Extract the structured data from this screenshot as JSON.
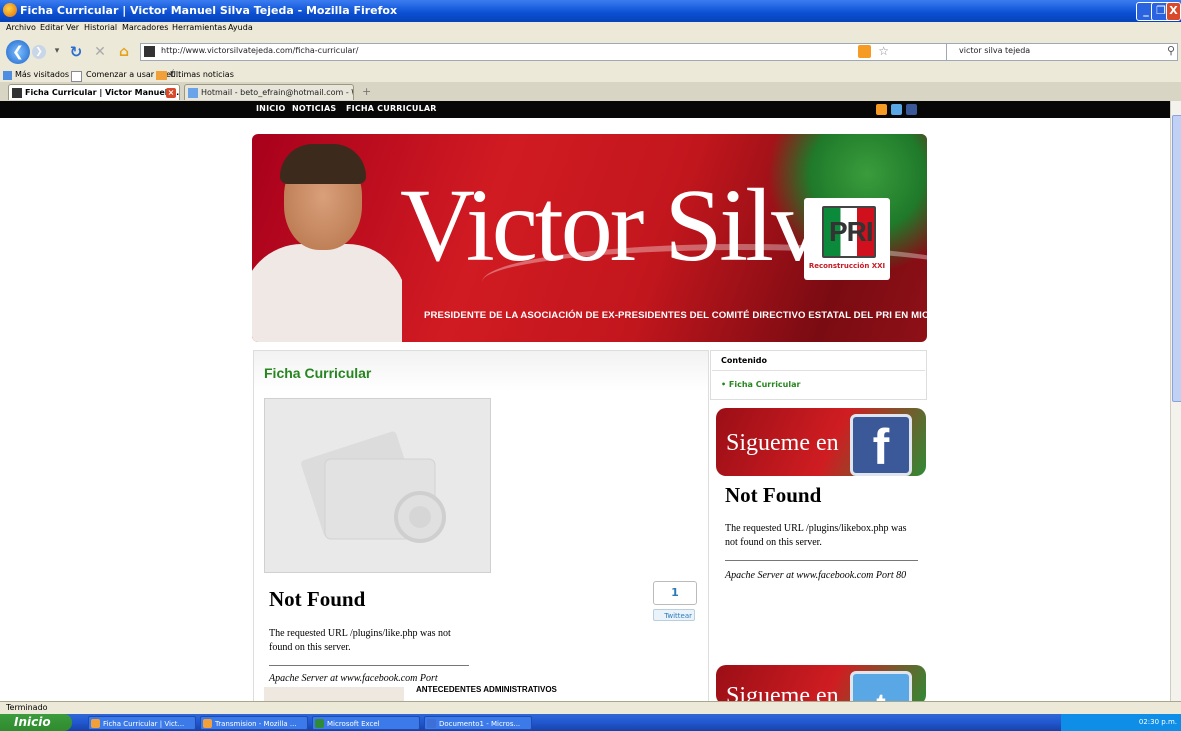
{
  "window": {
    "title": "Ficha Curricular | Victor Manuel Silva Tejeda - Mozilla Firefox",
    "controls": [
      "_",
      "❐",
      "X"
    ]
  },
  "menu": [
    "Archivo",
    "Editar",
    "Ver",
    "Historial",
    "Marcadores",
    "Herramientas",
    "Ayuda"
  ],
  "navigation": {
    "url": "http://www.victorsilvatejeda.com/ficha-curricular/",
    "search_value": "victor silva tejeda"
  },
  "bookmarks": [
    "Más visitados",
    "Comenzar a usar Firef...",
    "Últimas noticias"
  ],
  "tabs": [
    {
      "label": "Ficha Curricular | Victor Manuel S...",
      "active": true
    },
    {
      "label": "Hotmail - beto_efrain@hotmail.com - W...",
      "active": false
    }
  ],
  "site_nav": [
    "INICIO",
    "NOTICIAS",
    "FICHA CURRICULAR"
  ],
  "banner": {
    "name": "Victor Silva",
    "party": "PRI",
    "party_tagline": "Reconstrucción XXI",
    "subtitle": "PRESIDENTE DE LA ASOCIACIÓN DE EX-PRESIDENTES DEL COMITÉ DIRECTIVO ESTATAL DEL PRI EN MICHOACÁN"
  },
  "content": {
    "page_title": "Ficha Curricular",
    "like_error": {
      "heading": "Not Found",
      "text": "The requested URL /plugins/like.php was not found on this server.",
      "server": "Apache Server at www.facebook.com Port"
    },
    "tweet_count": "1",
    "tweet_button": "Twittear",
    "section_heading": "ANTECEDENTES ADMINISTRATIVOS"
  },
  "sidebar": {
    "contents_title": "Contenido",
    "contents_item": "Ficha Curricular",
    "facebook_badge": "Sigueme en",
    "likebox_error": {
      "heading": "Not Found",
      "text": "The requested URL /plugins/likebox.php was not found on this server.",
      "server": "Apache Server at www.facebook.com Port 80"
    },
    "twitter_badge": "Sigueme en"
  },
  "status": "Terminado",
  "taskbar": {
    "start": "Inicio",
    "items": [
      "Ficha Curricular | Vict...",
      "Transmision - Mozilla ...",
      "Microsoft Excel",
      "Documento1 - Micros..."
    ],
    "clock": "02:30 p.m."
  }
}
